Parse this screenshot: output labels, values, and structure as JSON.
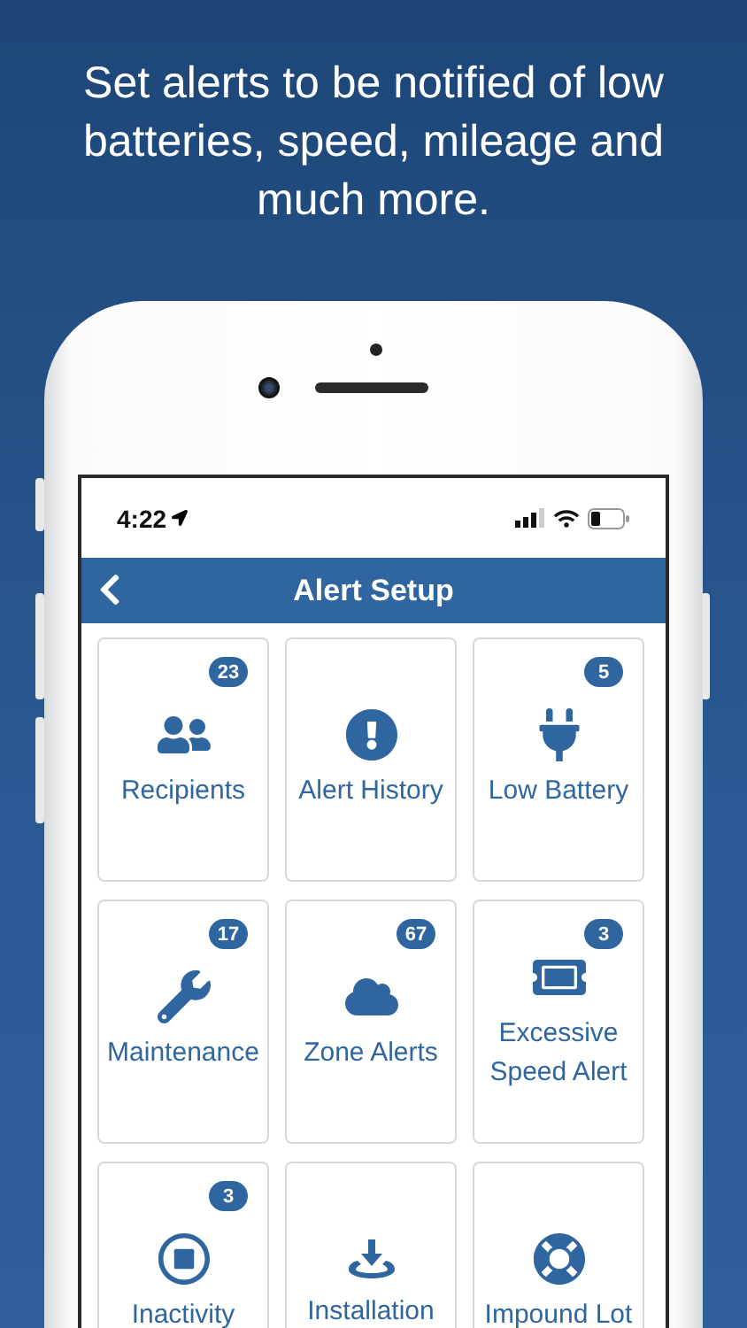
{
  "headline": "Set alerts to be notified of low batteries, speed, mileage and much more.",
  "status_bar": {
    "time": "4:22"
  },
  "nav_bar": {
    "title": "Alert Setup"
  },
  "tiles": [
    {
      "label": "Recipients",
      "badge": "23"
    },
    {
      "label": "Alert History"
    },
    {
      "label": "Low Battery",
      "badge": "5"
    },
    {
      "label": "Maintenance",
      "badge": "17"
    },
    {
      "label": "Zone Alerts",
      "badge": "67"
    },
    {
      "label": "Excessive Speed Alert",
      "badge": "3"
    },
    {
      "label": "Inactivity",
      "badge": "3"
    },
    {
      "label": "Installation"
    },
    {
      "label": "Impound Lot"
    }
  ]
}
